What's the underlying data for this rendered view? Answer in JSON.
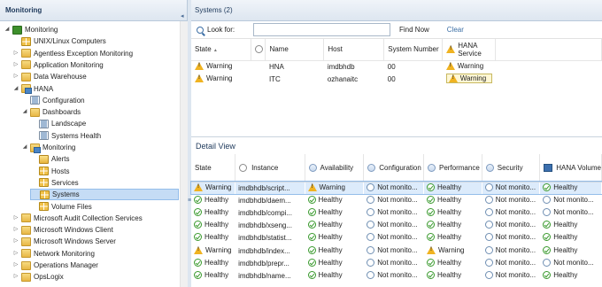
{
  "left_pane": {
    "title": "Monitoring",
    "collapse_glyph": "◂",
    "tree": [
      {
        "label": "Monitoring",
        "icon": "monitoring-icon",
        "expander": "◢",
        "indent": 0
      },
      {
        "label": "UNIX/Linux Computers",
        "icon": "state-view-icon",
        "expander": "",
        "indent": 1
      },
      {
        "label": "Agentless Exception Monitoring",
        "icon": "folder-icon",
        "expander": "▷",
        "indent": 1
      },
      {
        "label": "Application Monitoring",
        "icon": "folder-icon",
        "expander": "▷",
        "indent": 1
      },
      {
        "label": "Data Warehouse",
        "icon": "folder-icon",
        "expander": "▷",
        "indent": 1
      },
      {
        "label": "HANA",
        "icon": "folder-view-icon",
        "expander": "◢",
        "indent": 1
      },
      {
        "label": "Configuration",
        "icon": "page-icon",
        "expander": "",
        "indent": 2
      },
      {
        "label": "Dashboards",
        "icon": "folder-icon",
        "expander": "◢",
        "indent": 2
      },
      {
        "label": "Landscape",
        "icon": "page-icon",
        "expander": "",
        "indent": 3
      },
      {
        "label": "Systems Health",
        "icon": "page-icon",
        "expander": "",
        "indent": 3
      },
      {
        "label": "Monitoring",
        "icon": "folder-view-icon",
        "expander": "◢",
        "indent": 2
      },
      {
        "label": "Alerts",
        "icon": "alert-view-icon",
        "expander": "",
        "indent": 3
      },
      {
        "label": "Hosts",
        "icon": "state-view-icon",
        "expander": "",
        "indent": 3
      },
      {
        "label": "Services",
        "icon": "state-view-icon",
        "expander": "",
        "indent": 3
      },
      {
        "label": "Systems",
        "icon": "state-view-icon",
        "expander": "",
        "indent": 3,
        "selected": true
      },
      {
        "label": "Volume Files",
        "icon": "state-view-icon",
        "expander": "",
        "indent": 3
      },
      {
        "label": "Microsoft Audit Collection Services",
        "icon": "folder-icon",
        "expander": "▷",
        "indent": 1
      },
      {
        "label": "Microsoft Windows Client",
        "icon": "folder-icon",
        "expander": "▷",
        "indent": 1
      },
      {
        "label": "Microsoft Windows Server",
        "icon": "folder-icon",
        "expander": "▷",
        "indent": 1
      },
      {
        "label": "Network Monitoring",
        "icon": "folder-icon",
        "expander": "▷",
        "indent": 1
      },
      {
        "label": "Operations Manager",
        "icon": "folder-icon",
        "expander": "▷",
        "indent": 1
      },
      {
        "label": "OpsLogix",
        "icon": "folder-icon",
        "expander": "▷",
        "indent": 1
      }
    ]
  },
  "right_pane": {
    "title": "Systems (2)",
    "find": {
      "look_for_label": "Look for:",
      "input_value": "",
      "find_now_label": "Find Now",
      "clear_label": "Clear"
    },
    "systems_grid": {
      "columns": [
        "State",
        "",
        "Name",
        "Host",
        "System Number",
        "HANA Service"
      ],
      "rows": [
        {
          "state": "Warning",
          "name": "HNA",
          "host": "imdbhdb",
          "system_number": "00",
          "hana_service": "Warning"
        },
        {
          "state": "Warning",
          "name": "ITC",
          "host": "ozhanaitc",
          "system_number": "00",
          "hana_service": "Warning"
        }
      ]
    },
    "detail_view": {
      "title": "Detail View",
      "columns": [
        "State",
        "Instance",
        "Availability",
        "Configuration",
        "Performance",
        "Security",
        "HANA Volume"
      ],
      "rows": [
        {
          "state": "Warning",
          "instance": "imdbhdb/script...",
          "availability": "Warning",
          "configuration": "Not monito...",
          "performance": "Healthy",
          "security": "Not monito...",
          "hana_volume": "Healthy",
          "selected": true
        },
        {
          "state": "Healthy",
          "instance": "imdbhdb/daem...",
          "availability": "Healthy",
          "configuration": "Not monito...",
          "performance": "Healthy",
          "security": "Not monito...",
          "hana_volume": "Not monito..."
        },
        {
          "state": "Healthy",
          "instance": "imdbhdb/compi...",
          "availability": "Healthy",
          "configuration": "Not monito...",
          "performance": "Healthy",
          "security": "Not monito...",
          "hana_volume": "Not monito..."
        },
        {
          "state": "Healthy",
          "instance": "imdbhdb/xseng...",
          "availability": "Healthy",
          "configuration": "Not monito...",
          "performance": "Healthy",
          "security": "Not monito...",
          "hana_volume": "Healthy"
        },
        {
          "state": "Healthy",
          "instance": "imdbhdb/statist...",
          "availability": "Healthy",
          "configuration": "Not monito...",
          "performance": "Healthy",
          "security": "Not monito...",
          "hana_volume": "Healthy"
        },
        {
          "state": "Warning",
          "instance": "imdbhdb/index...",
          "availability": "Healthy",
          "configuration": "Not monito...",
          "performance": "Warning",
          "security": "Not monito...",
          "hana_volume": "Healthy"
        },
        {
          "state": "Healthy",
          "instance": "imdbhdb/prepr...",
          "availability": "Healthy",
          "configuration": "Not monito...",
          "performance": "Healthy",
          "security": "Not monito...",
          "hana_volume": "Not monito..."
        },
        {
          "state": "Healthy",
          "instance": "imdbhdb/name...",
          "availability": "Healthy",
          "configuration": "Not monito...",
          "performance": "Healthy",
          "security": "Not monito...",
          "hana_volume": "Healthy"
        }
      ]
    }
  },
  "colors": {
    "header_text": "#1e395b",
    "selection": "#c5dcf5",
    "healthy": "#3a9a2e",
    "warning": "#f0b321"
  }
}
